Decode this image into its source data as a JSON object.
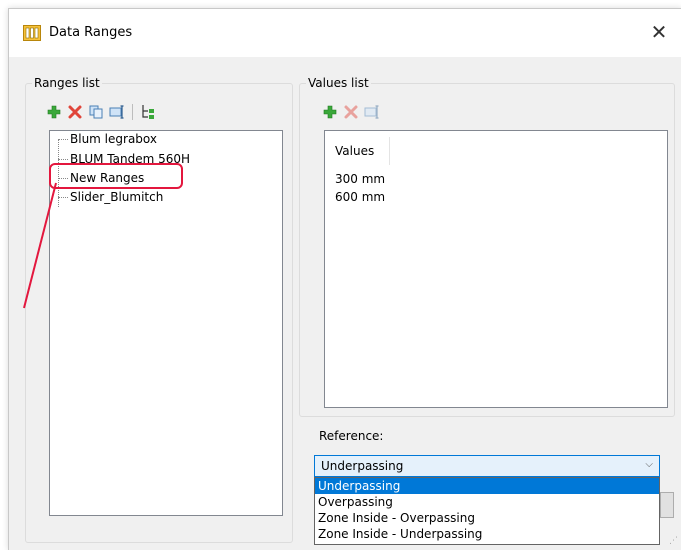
{
  "window": {
    "title": "Data Ranges",
    "close_glyph": "✕"
  },
  "ranges": {
    "group_label": "Ranges list",
    "toolbar": [
      "add-icon",
      "delete-icon",
      "copy-icon",
      "rename-icon",
      "tree-view-icon"
    ],
    "items": [
      {
        "label": "Blum legrabox"
      },
      {
        "label": "BLUM Tandem 560H"
      },
      {
        "label": "New Ranges",
        "highlighted": true
      },
      {
        "label": "Slider_Blumitch"
      }
    ]
  },
  "values": {
    "group_label": "Values list",
    "toolbar": [
      "add-icon",
      "delete-icon",
      "rename-icon"
    ],
    "column_header": "Values",
    "items": [
      "300 mm",
      "600 mm"
    ]
  },
  "reference": {
    "label": "Reference:",
    "selected": "Underpassing",
    "options": [
      "Underpassing",
      "Overpassing",
      "Zone Inside - Overpassing",
      "Zone Inside - Underpassing"
    ],
    "selected_index": 0
  },
  "colors": {
    "annotation": "#e3173e",
    "selection": "#0078d7",
    "add_icon": "#3aa83a",
    "delete_icon": "#e0453a"
  }
}
